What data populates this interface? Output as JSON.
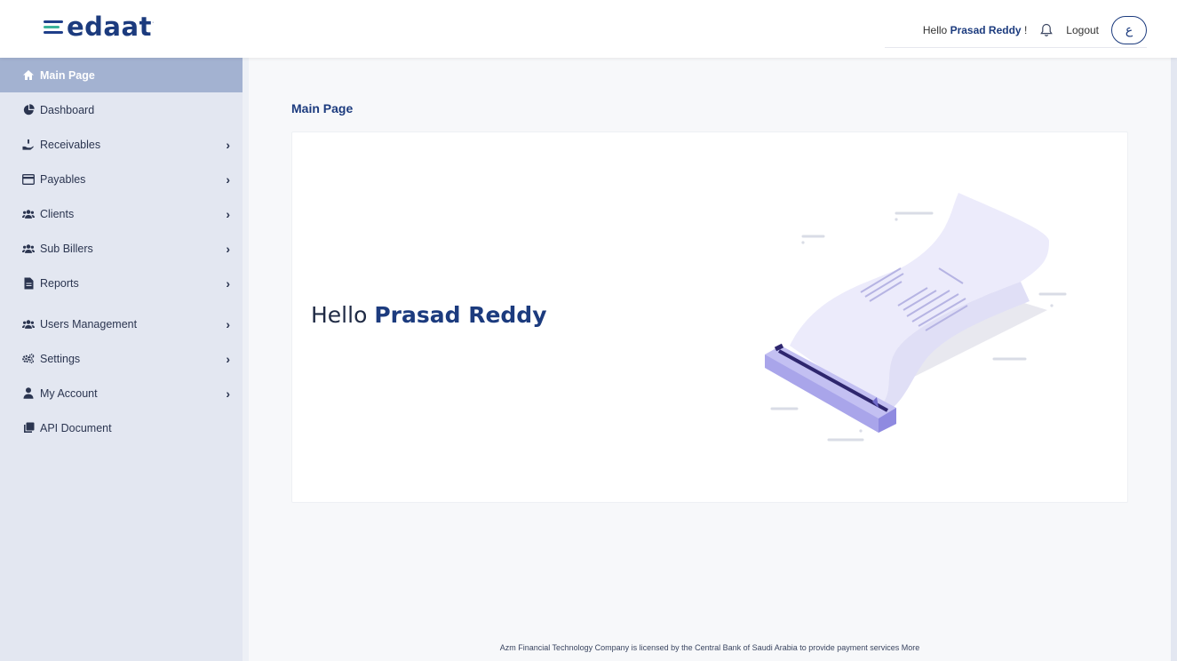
{
  "header": {
    "logo_text": "edaat",
    "logo_mark": "·",
    "greeting_prefix": "Hello",
    "user_name": "Prasad Reddy",
    "greeting_suffix": "!",
    "logout_label": "Logout",
    "language_label": "ع"
  },
  "sidebar": {
    "items": [
      {
        "label": "Main Page",
        "icon": "home-icon",
        "active": true,
        "expandable": false
      },
      {
        "label": "Dashboard",
        "icon": "pie-chart-icon",
        "active": false,
        "expandable": false
      },
      {
        "label": "Receivables",
        "icon": "hand-coin-icon",
        "active": false,
        "expandable": true
      },
      {
        "label": "Payables",
        "icon": "credit-card-icon",
        "active": false,
        "expandable": true
      },
      {
        "label": "Clients",
        "icon": "users-icon",
        "active": false,
        "expandable": true
      },
      {
        "label": "Sub Billers",
        "icon": "users-icon",
        "active": false,
        "expandable": true
      },
      {
        "label": "Reports",
        "icon": "file-icon",
        "active": false,
        "expandable": true
      },
      {
        "label": "Users Management",
        "icon": "users-icon",
        "active": false,
        "expandable": true
      },
      {
        "label": "Settings",
        "icon": "gears-icon",
        "active": false,
        "expandable": true
      },
      {
        "label": "My Account",
        "icon": "user-icon",
        "active": false,
        "expandable": true
      },
      {
        "label": "API Document",
        "icon": "copy-icon",
        "active": false,
        "expandable": false
      }
    ]
  },
  "main": {
    "page_title": "Main Page",
    "greeting_prefix": "Hello",
    "greeting_name": "Prasad Reddy"
  },
  "footer": {
    "text": "Azm Financial Technology Company is licensed by the Central Bank of Saudi Arabia to provide payment services More"
  },
  "colors": {
    "brand": "#1c3b7e",
    "sidebar_bg": "#e3e7f1",
    "active_item": "#a3b2d1"
  }
}
